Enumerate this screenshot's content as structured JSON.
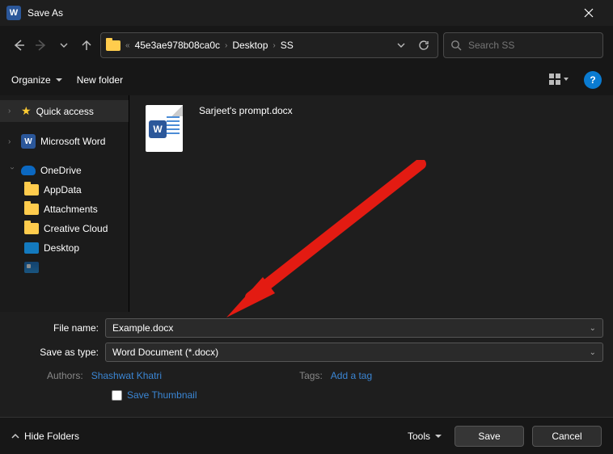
{
  "window": {
    "title": "Save As"
  },
  "nav": {
    "path_segments": [
      "45e3ae978b08ca0c",
      "Desktop",
      "SS"
    ],
    "search_placeholder": "Search SS"
  },
  "toolbar": {
    "organize": "Organize",
    "new_folder": "New folder"
  },
  "sidebar": {
    "quick_access": "Quick access",
    "microsoft_word": "Microsoft Word",
    "onedrive": "OneDrive",
    "items": [
      "AppData",
      "Attachments",
      "Creative Cloud",
      "Desktop"
    ]
  },
  "content": {
    "files": [
      {
        "name": "Sarjeet's prompt.docx"
      }
    ]
  },
  "fields": {
    "filename_label": "File name:",
    "filename_value": "Example.docx",
    "savetype_label": "Save as type:",
    "savetype_value": "Word Document (*.docx)"
  },
  "meta": {
    "authors_label": "Authors:",
    "authors_value": "Shashwat Khatri",
    "tags_label": "Tags:",
    "tags_value": "Add a tag",
    "save_thumbnail": "Save Thumbnail"
  },
  "bottom": {
    "hide_folders": "Hide Folders",
    "tools": "Tools",
    "save": "Save",
    "cancel": "Cancel"
  }
}
